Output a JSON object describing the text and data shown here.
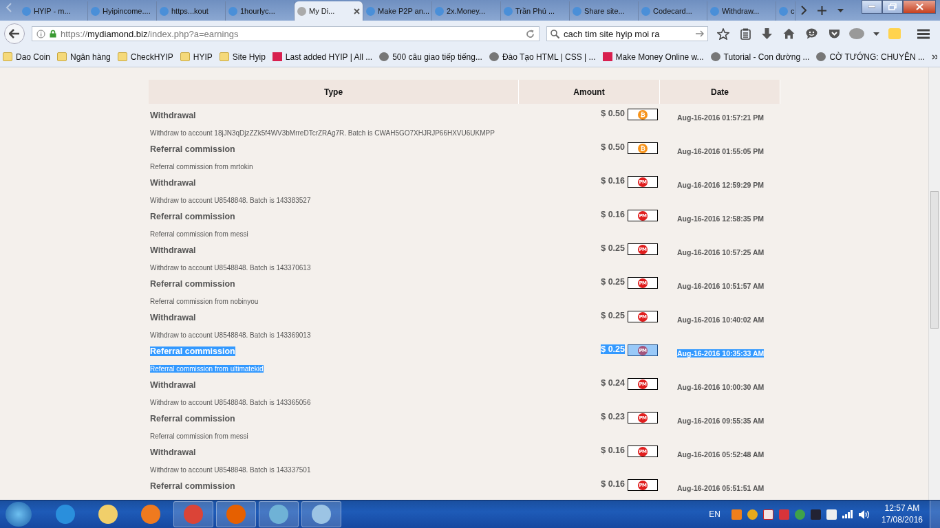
{
  "browser": {
    "tabs": [
      {
        "label": "HYIP - m...",
        "selected": false
      },
      {
        "label": "Hyipincome....",
        "selected": false
      },
      {
        "label": "https...kout",
        "selected": false
      },
      {
        "label": "1hourlyc...",
        "selected": false
      },
      {
        "label": "My Di...",
        "selected": true
      },
      {
        "label": "Make P2P an...",
        "selected": false
      },
      {
        "label": "2x.Money...",
        "selected": false
      },
      {
        "label": "Trần Phú ...",
        "selected": false
      },
      {
        "label": "Share site...",
        "selected": false
      },
      {
        "label": "Codecard...",
        "selected": false
      },
      {
        "label": "Withdraw...",
        "selected": false
      },
      {
        "label": "c",
        "selected": false
      }
    ],
    "url": {
      "scheme": "https://",
      "host": "mydiamond.biz",
      "path": "/index.php?a=earnings"
    },
    "search": {
      "value": "cach tim site hyip moi ra"
    },
    "bookmarks": [
      {
        "label": "Dao Coin",
        "kind": "folder"
      },
      {
        "label": "Ngân hàng",
        "kind": "folder"
      },
      {
        "label": "CheckHYIP",
        "kind": "folder"
      },
      {
        "label": "HYIP",
        "kind": "folder"
      },
      {
        "label": "Site Hyip",
        "kind": "folder"
      },
      {
        "label": "Last added HYIP | All ...",
        "kind": "site"
      },
      {
        "label": "500 câu giao tiếp tiếng...",
        "kind": "globe"
      },
      {
        "label": "Đào Tạo HTML | CSS | ...",
        "kind": "globe"
      },
      {
        "label": "Make Money Online w...",
        "kind": "site"
      },
      {
        "label": "Tutorial - Con đường ...",
        "kind": "globe"
      },
      {
        "label": "CỜ TƯỚNG: CHUYÊN ...",
        "kind": "globe"
      }
    ]
  },
  "table": {
    "columns": [
      "Type",
      "Amount",
      "Date"
    ],
    "rows": [
      {
        "type": "Withdrawal",
        "amount": "$ 0.50",
        "currency": {
          "kind": "btc",
          "symbol": "₿"
        },
        "date": "Aug-16-2016 01:57:21 PM",
        "detail": "Withdraw to account 18jJN3qDjzZZk5f4WV3bMrreDTcrZRAg7R. Batch is CWAH5GO7XHJRJP66HXVU6UKMPP",
        "selected": false
      },
      {
        "type": "Referral commission",
        "amount": "$ 0.50",
        "currency": {
          "kind": "btc",
          "symbol": "₿"
        },
        "date": "Aug-16-2016 01:55:05 PM",
        "detail": "Referral commission from mrtokin",
        "selected": false
      },
      {
        "type": "Withdrawal",
        "amount": "$ 0.16",
        "currency": {
          "kind": "pm",
          "symbol": "PM"
        },
        "date": "Aug-16-2016 12:59:29 PM",
        "detail": "Withdraw to account U8548848. Batch is 143383527",
        "selected": false
      },
      {
        "type": "Referral commission",
        "amount": "$ 0.16",
        "currency": {
          "kind": "pm",
          "symbol": "PM"
        },
        "date": "Aug-16-2016 12:58:35 PM",
        "detail": "Referral commission from messi",
        "selected": false
      },
      {
        "type": "Withdrawal",
        "amount": "$ 0.25",
        "currency": {
          "kind": "pm",
          "symbol": "PM"
        },
        "date": "Aug-16-2016 10:57:25 AM",
        "detail": "Withdraw to account U8548848. Batch is 143370613",
        "selected": false
      },
      {
        "type": "Referral commission",
        "amount": "$ 0.25",
        "currency": {
          "kind": "pm",
          "symbol": "PM"
        },
        "date": "Aug-16-2016 10:51:57 AM",
        "detail": "Referral commission from nobinyou",
        "selected": false
      },
      {
        "type": "Withdrawal",
        "amount": "$ 0.25",
        "currency": {
          "kind": "pm",
          "symbol": "PM"
        },
        "date": "Aug-16-2016 10:40:02 AM",
        "detail": "Withdraw to account U8548848. Batch is 143369013",
        "selected": false
      },
      {
        "type": "Referral commission",
        "amount": "$ 0.25",
        "currency": {
          "kind": "pm",
          "symbol": "PM"
        },
        "date": "Aug-16-2016 10:35:33 AM",
        "detail": "Referral commission from ultimatekid",
        "selected": true
      },
      {
        "type": "Withdrawal",
        "amount": "$ 0.24",
        "currency": {
          "kind": "pm",
          "symbol": "PM"
        },
        "date": "Aug-16-2016 10:00:30 AM",
        "detail": "Withdraw to account U8548848. Batch is 143365056",
        "selected": false
      },
      {
        "type": "Referral commission",
        "amount": "$ 0.23",
        "currency": {
          "kind": "pm",
          "symbol": "PM"
        },
        "date": "Aug-16-2016 09:55:35 AM",
        "detail": "Referral commission from messi",
        "selected": false
      },
      {
        "type": "Withdrawal",
        "amount": "$ 0.16",
        "currency": {
          "kind": "pm",
          "symbol": "PM"
        },
        "date": "Aug-16-2016 05:52:48 AM",
        "detail": "Withdraw to account U8548848. Batch is 143337501",
        "selected": false
      },
      {
        "type": "Referral commission",
        "amount": "$ 0.16",
        "currency": {
          "kind": "pm",
          "symbol": "PM"
        },
        "date": "Aug-16-2016 05:51:51 AM",
        "selected": false
      }
    ]
  },
  "taskbar": {
    "apps": [
      {
        "kind": "ie",
        "selected": false
      },
      {
        "kind": "folder",
        "selected": false
      },
      {
        "kind": "media",
        "selected": false
      },
      {
        "kind": "chrome",
        "selected": true
      },
      {
        "kind": "firefox",
        "selected": true
      },
      {
        "kind": "shield",
        "selected": true
      },
      {
        "kind": "calc",
        "selected": true
      }
    ],
    "language": "EN",
    "time": "12:57 AM",
    "date": "17/08/2016"
  }
}
